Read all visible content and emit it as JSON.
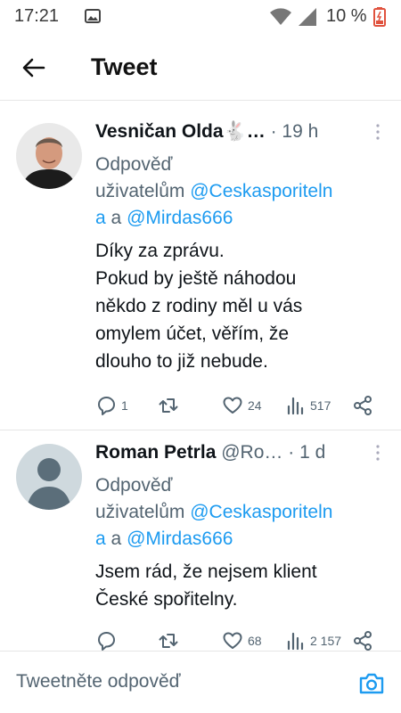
{
  "status_bar": {
    "time": "17:21",
    "battery": "10 %",
    "icons": [
      "photo-icon",
      "wifi-icon",
      "signal-icon",
      "battery-low-icon"
    ]
  },
  "header": {
    "title": "Tweet",
    "back_icon": "arrow-left-icon"
  },
  "tweets": [
    {
      "name": "Vesničan Olda🐇…",
      "dot": "·",
      "time": "19 h",
      "reply_prefix": "Odpověď",
      "reply_users_prefix": "uživatelům",
      "reply_mention_1a": "@Ceskasporiteln",
      "reply_mention_1b": "a",
      "reply_and": "a",
      "reply_mention_2": "@Mirdas666",
      "body": [
        "Díky za zprávu.",
        "Pokud by ještě náhodou",
        "někdo z rodiny měl u vás",
        "omylem účet, věřím, že",
        "dlouho to již nebude."
      ],
      "replies": "1",
      "retweets": "",
      "likes": "24",
      "views": "517"
    },
    {
      "name": "Roman Petrla",
      "handle": "@Ro…",
      "dot": "·",
      "time": "1 d",
      "reply_prefix": "Odpověď",
      "reply_users_prefix": "uživatelům",
      "reply_mention_1a": "@Ceskasporiteln",
      "reply_mention_1b": "a",
      "reply_and": "a",
      "reply_mention_2": "@Mirdas666",
      "body": [
        "Jsem rád, že nejsem klient",
        "České spořitelny."
      ],
      "replies": "",
      "retweets": "",
      "likes": "68",
      "views": "2 157"
    }
  ],
  "reply_bar": {
    "placeholder": "Tweetněte odpověď",
    "camera_icon": "camera-icon"
  },
  "colors": {
    "accent": "#1d9bf0",
    "muted": "#536471",
    "text": "#0f1419",
    "divider": "#e6e6e6",
    "battery_low": "#e0523e"
  }
}
